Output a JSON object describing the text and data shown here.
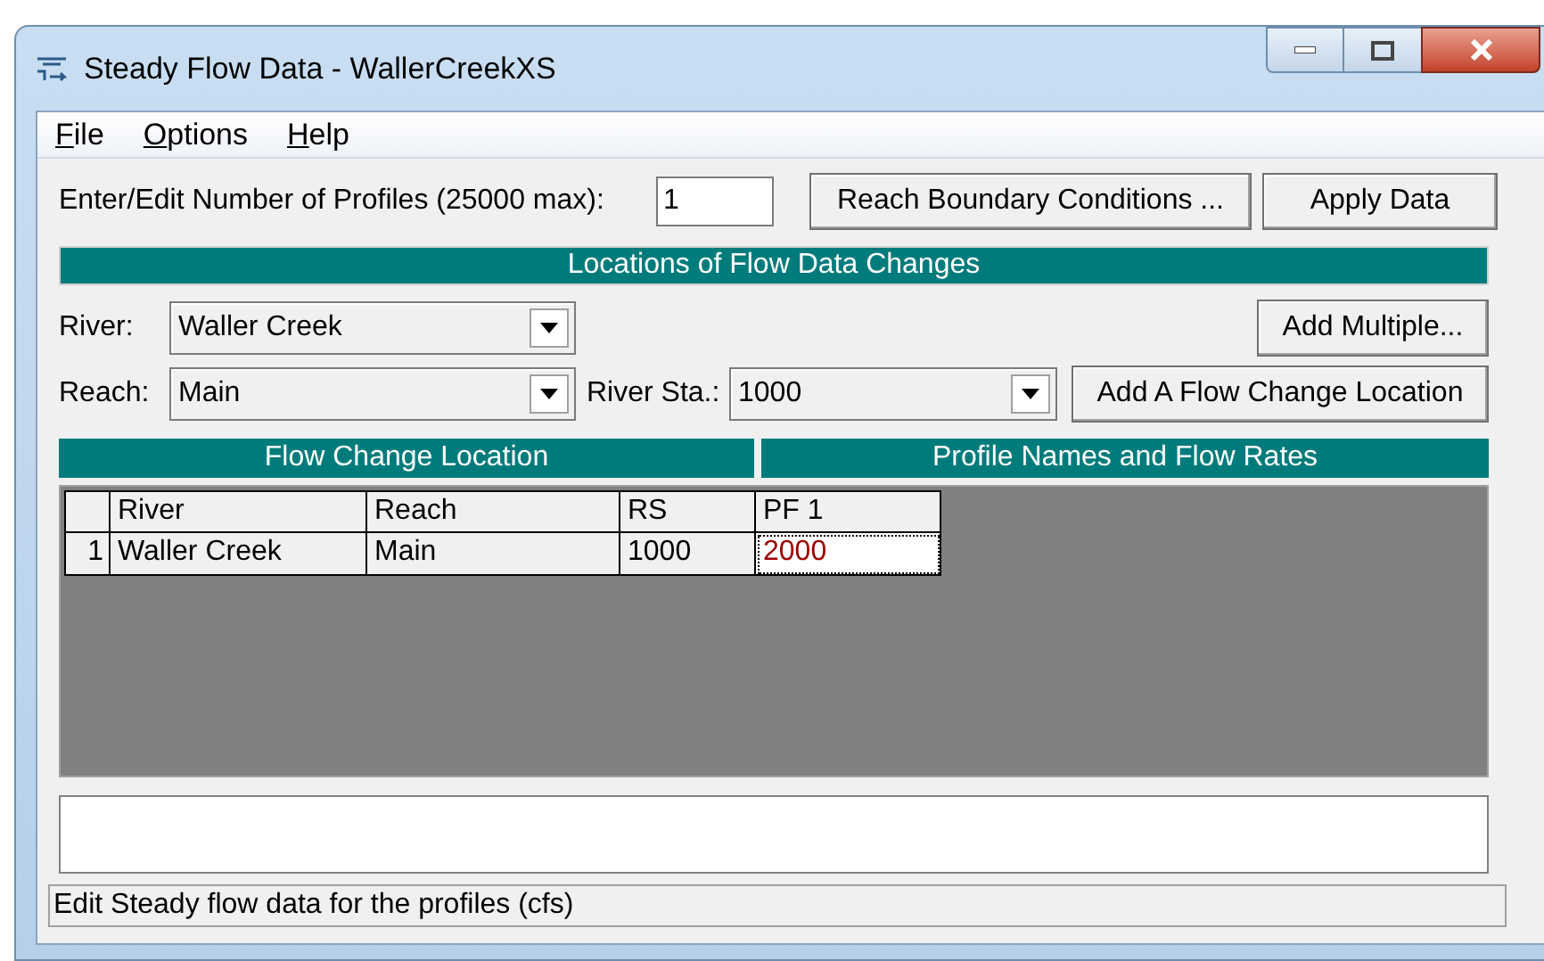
{
  "window": {
    "title": "Steady Flow Data - WallerCreekXS"
  },
  "menu": [
    "File",
    "Options",
    "Help"
  ],
  "profiles": {
    "label": "Enter/Edit Number of Profiles (25000 max):",
    "value": "1"
  },
  "top_buttons": [
    "Reach Boundary Conditions ...",
    "Apply Data"
  ],
  "locations_header": "Locations of Flow Data Changes",
  "river": {
    "label": "River:",
    "value": "Waller Creek"
  },
  "add_multiple": "Add Multiple...",
  "reach": {
    "label": "Reach:",
    "value": "Main"
  },
  "river_station": {
    "label": "River Sta.:",
    "value": "1000"
  },
  "add_location": "Add A Flow Change Location",
  "table": {
    "group_headers": [
      "Flow Change Location",
      "Profile Names and Flow Rates"
    ],
    "columns": [
      "River",
      "Reach",
      "RS",
      "PF 1"
    ],
    "rows": [
      {
        "number": "1",
        "cells": [
          "Waller Creek",
          "Main",
          "1000",
          "2000"
        ]
      }
    ]
  },
  "status_bar": "Edit Steady flow data for the profiles (cfs)"
}
